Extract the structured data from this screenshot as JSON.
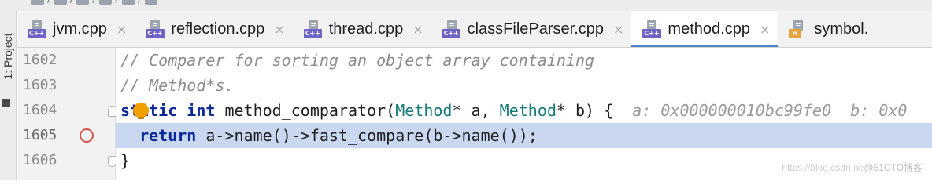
{
  "breadcrumbs": [],
  "sidebar": {
    "label": "1: Project"
  },
  "tabs": [
    {
      "label": "jvm.cpp",
      "type": "C++",
      "active": false,
      "close": "×"
    },
    {
      "label": "reflection.cpp",
      "type": "C++",
      "active": false,
      "close": "×"
    },
    {
      "label": "thread.cpp",
      "type": "C++",
      "active": false,
      "close": "×"
    },
    {
      "label": "classFileParser.cpp",
      "type": "C++",
      "active": false,
      "close": "×"
    },
    {
      "label": "method.cpp",
      "type": "C++",
      "active": true,
      "close": "×"
    },
    {
      "label": "symbol.",
      "type": "H",
      "active": false,
      "close": ""
    }
  ],
  "editor": {
    "lines": [
      {
        "number": "1602",
        "tokens": [
          {
            "t": "// Comparer for sorting an object array containing",
            "k": "comment"
          }
        ]
      },
      {
        "number": "1603",
        "tokens": [
          {
            "t": "// Method*s.",
            "k": "comment"
          }
        ]
      },
      {
        "number": "1604",
        "tokens": [
          {
            "t": "static",
            "k": "kw"
          },
          {
            "t": " ",
            "k": "ident"
          },
          {
            "t": "int",
            "k": "kw"
          },
          {
            "t": " method_comparator(",
            "k": "ident"
          },
          {
            "t": "Method",
            "k": "type"
          },
          {
            "t": "* a, ",
            "k": "ident"
          },
          {
            "t": "Method",
            "k": "type"
          },
          {
            "t": "* b) {  ",
            "k": "ident"
          },
          {
            "t": "a: 0x000000010bc99fe0  b: 0x0",
            "k": "hint"
          }
        ]
      },
      {
        "number": "1605",
        "tokens": [
          {
            "t": "  ",
            "k": "ident"
          },
          {
            "t": "return",
            "k": "kw"
          },
          {
            "t": " a->name()->fast_compare(b->name());",
            "k": "ident"
          }
        ]
      },
      {
        "number": "1606",
        "tokens": [
          {
            "t": "}",
            "k": "ident"
          }
        ]
      }
    ],
    "current_line": "1605",
    "breakpoint_line": "1605"
  },
  "watermark": {
    "url": "https://blog.csdn.ne",
    "brand": "@51CTO博客"
  },
  "colors": {
    "execution_highlight": "#c9d7f1",
    "breakpoint": "#d9534f",
    "keyword": "#0b2a9a",
    "type": "#1a7a7a",
    "active_tab_underline": "#4a86c8"
  }
}
